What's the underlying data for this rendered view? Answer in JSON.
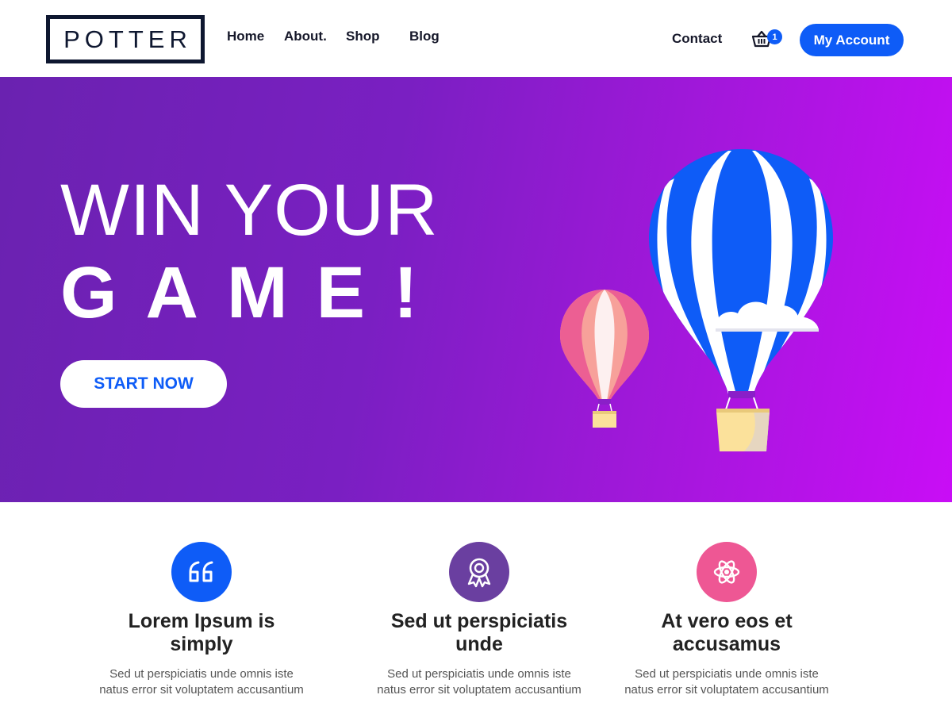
{
  "brand": {
    "logo_text": "POTTER"
  },
  "nav": {
    "items": [
      {
        "label": "Home"
      },
      {
        "label": "About."
      },
      {
        "label": "Shop"
      },
      {
        "label": "Blog"
      }
    ],
    "contact": "Contact",
    "cart_count": "1",
    "account_label": "My Account"
  },
  "hero": {
    "line1": "WIN YOUR",
    "line2": "GAME!",
    "cta_label": "START NOW"
  },
  "features": [
    {
      "icon": "quote-icon",
      "color": "#0e5cf7",
      "title": "Lorem Ipsum is simply",
      "text": "Sed ut perspiciatis unde omnis iste natus error sit voluptatem accusantium"
    },
    {
      "icon": "award-icon",
      "color": "#6a3fa0",
      "title": "Sed ut perspiciatis unde",
      "text": "Sed ut perspiciatis unde omnis iste natus error sit voluptatem accusantium"
    },
    {
      "icon": "atom-icon",
      "color": "#ee5794",
      "title": "At vero eos et accusamus",
      "text": "Sed ut perspiciatis unde omnis iste natus error sit voluptatem accusantium"
    }
  ],
  "colors": {
    "accent": "#0e5cf7",
    "hero_start": "#6a22b0",
    "hero_end": "#c90df6",
    "dark": "#0e1730"
  }
}
